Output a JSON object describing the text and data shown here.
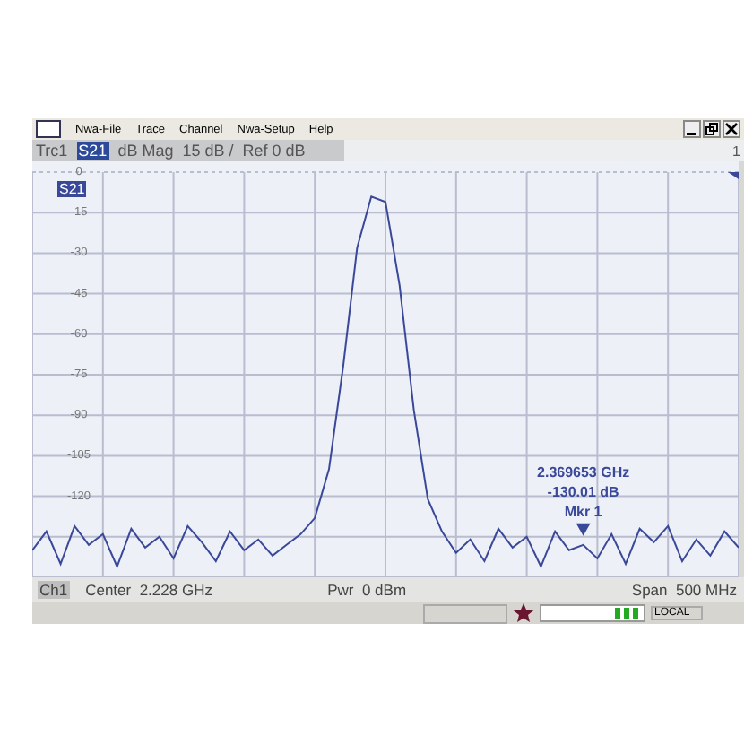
{
  "menu": [
    "Nwa-File",
    "Trace",
    "Channel",
    "Nwa-Setup",
    "Help"
  ],
  "trace_header": {
    "trace": "Trc1",
    "parameter": "S21",
    "format": "dB Mag",
    "scale": "15 dB /",
    "reference": "Ref 0 dB",
    "channel_number": "1"
  },
  "chart_data": {
    "type": "line",
    "grid": true,
    "ylim": [
      -150,
      0
    ],
    "yticks": [
      {
        "value": 0,
        "label": "0"
      },
      {
        "value": -15,
        "label": "-15"
      },
      {
        "value": -30,
        "label": "-30"
      },
      {
        "value": -45,
        "label": "-45"
      },
      {
        "value": -60,
        "label": "-60"
      },
      {
        "value": -75,
        "label": "-75"
      },
      {
        "value": -90,
        "label": "-90"
      },
      {
        "value": -105,
        "label": "-105"
      },
      {
        "value": -120,
        "label": "-120"
      }
    ],
    "categories": [
      null,
      null,
      null,
      null,
      null,
      null,
      null,
      null,
      null,
      null,
      null,
      null,
      null,
      null,
      null,
      null,
      null,
      null,
      null,
      null,
      null,
      null,
      null,
      null,
      null,
      null,
      null,
      null,
      null,
      null,
      null,
      null,
      null,
      null,
      null,
      null,
      null,
      null,
      null,
      null,
      null,
      null,
      null,
      null,
      null,
      null,
      null,
      null,
      null,
      null,
      null
    ],
    "series": [
      {
        "name": "S21",
        "color": "#3a4899",
        "values": [
          -140,
          -133,
          -145,
          -131,
          -138,
          -134,
          -146,
          -132,
          -139,
          -135,
          -143,
          -131,
          -137,
          -144,
          -133,
          -140,
          -136,
          -142,
          -138,
          -134,
          -128,
          -110,
          -72,
          -28,
          -9,
          -11,
          -42,
          -88,
          -121,
          -133,
          -141,
          -136,
          -144,
          -132,
          -139,
          -135,
          -146,
          -133,
          -140,
          -138,
          -143,
          -134,
          -145,
          -132,
          -137,
          -131,
          -144,
          -136,
          -142,
          -133,
          -139
        ]
      }
    ]
  },
  "markers": [
    {
      "frequency": "2.369653 GHz",
      "level": "-130.01 dB",
      "label": "Mkr 1"
    }
  ],
  "channel_bar": {
    "channel": "Ch1",
    "center": "Center  2.228 GHz",
    "power": "Pwr  0 dBm",
    "span": "Span  500 MHz"
  },
  "status_bar": {
    "mode": "LOCAL"
  }
}
